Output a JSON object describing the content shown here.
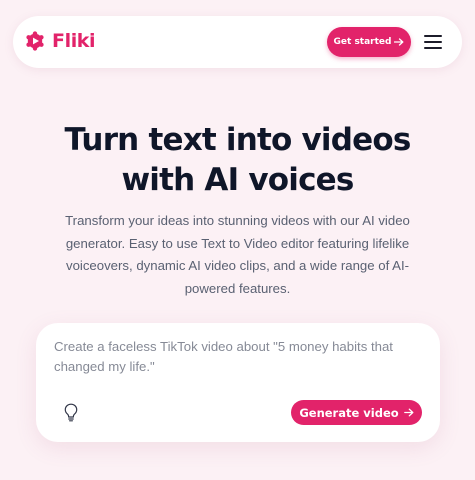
{
  "brand": {
    "name": "Fliki",
    "color": "#e2236a",
    "logo_icon": "play-badge-icon"
  },
  "header": {
    "cta_label": "Get started",
    "cta_icon": "arrow-right-icon",
    "menu_icon": "hamburger-menu-icon"
  },
  "hero": {
    "title_line1": "Turn text into videos",
    "title_line2": "with AI voices",
    "subtitle": "Transform your ideas into stunning videos with our AI video generator. Easy to use Text to Video editor featuring lifelike voiceovers, dynamic AI video clips, and a wide range of AI-powered features."
  },
  "prompt": {
    "placeholder": "Create a faceless TikTok video about \"5 money habits that changed my life.\"",
    "value": "",
    "idea_icon": "lightbulb-icon",
    "submit_label": "Generate video",
    "submit_icon": "arrow-right-icon"
  },
  "colors": {
    "background": "#fcf1f5",
    "accent": "#e2236a",
    "heading": "#0f1629",
    "body_text": "#5a6172",
    "placeholder": "#868a96"
  }
}
